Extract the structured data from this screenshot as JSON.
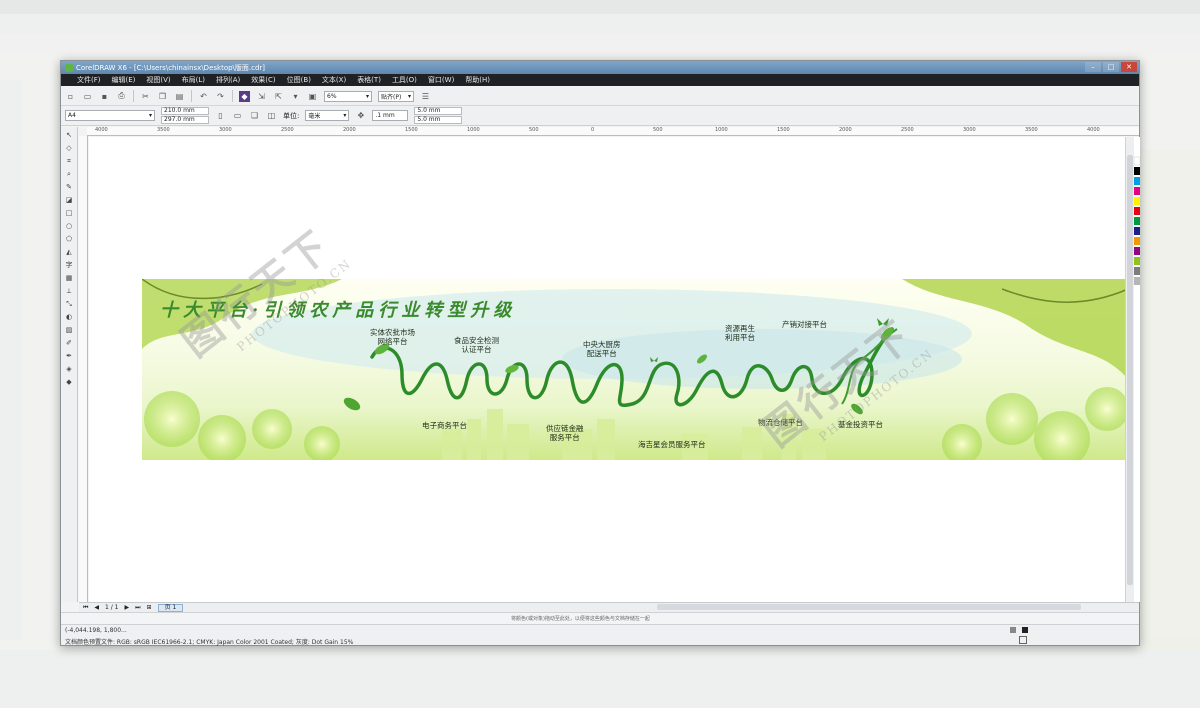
{
  "window": {
    "title": "CorelDRAW X6 - [C:\\Users\\chinainsx\\Desktop\\版面.cdr]",
    "buttons": {
      "minimize": "–",
      "maximize": "□",
      "close": "✕"
    }
  },
  "menu": [
    "文件(F)",
    "编辑(E)",
    "视图(V)",
    "布局(L)",
    "排列(A)",
    "效果(C)",
    "位图(B)",
    "文本(X)",
    "表格(T)",
    "工具(O)",
    "窗口(W)",
    "帮助(H)"
  ],
  "toolbar": {
    "zoom_value": "6%",
    "snap_label": "贴齐(P)"
  },
  "property_bar": {
    "page_size": "A4",
    "width": "210.0 mm",
    "height": "297.0 mm",
    "units_label": "单位:",
    "units_value": "毫米",
    "nudge": ".1 mm",
    "dup_x": "5.0 mm",
    "dup_y": "5.0 mm"
  },
  "ruler": {
    "ticks": [
      "4000",
      "3500",
      "3000",
      "2500",
      "2000",
      "1500",
      "1000",
      "500",
      "0",
      "500",
      "1000",
      "1500",
      "2000",
      "2500",
      "3000",
      "3500",
      "4000"
    ]
  },
  "pagebar": {
    "page_counter": "1 / 1",
    "page_tab": "页 1"
  },
  "hint": "将颜色(或对象)拖动至此处，以便将这些颜色与文档存储在一起",
  "status": {
    "coords": "(-4,044.198, 1,800...",
    "profile": "文档颜色预置文件: RGB: sRGB IEC61966-2.1; CMYK: Japan Color 2001 Coated; 灰度: Dot Gain 15%"
  },
  "banner": {
    "title": "十大平台·引领农产品行业转型升级",
    "platforms": {
      "p1": "实体农批市场\n网络平台",
      "p2": "食品安全检测\n认证平台",
      "p3": "中央大厨房\n配送平台",
      "p4": "资源再生\n利用平台",
      "p5": "产销对接平台",
      "p6": "电子商务平台",
      "p7": "供应链金融\n服务平台",
      "p8": "海吉星会员服务平台",
      "p9": "物流仓储平台",
      "p10": "基金投资平台"
    }
  },
  "watermark": {
    "main": "图行天下",
    "sub": "PHOTOPHOTO.CN"
  }
}
